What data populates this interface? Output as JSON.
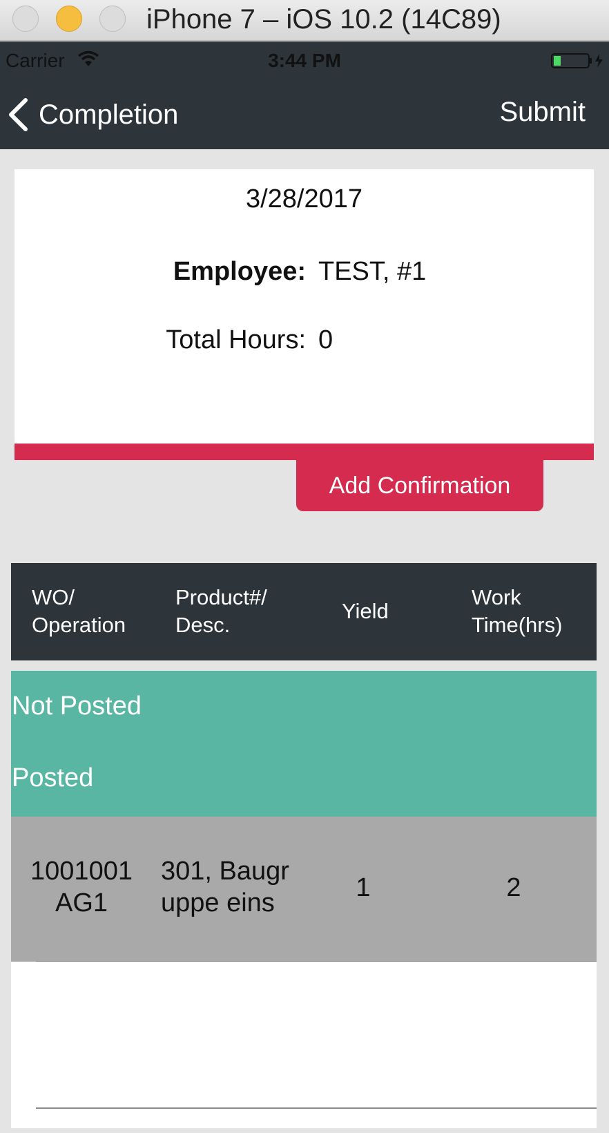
{
  "window": {
    "title": "iPhone 7 – iOS 10.2 (14C89)"
  },
  "status_bar": {
    "carrier": "Carrier",
    "time": "3:44 PM"
  },
  "nav": {
    "back_label": "Completion",
    "submit_label": "Submit"
  },
  "summary": {
    "date": "3/28/2017",
    "employee_label": "Employee:",
    "employee_value": "TEST, #1",
    "hours_label": "Total Hours:",
    "hours_value": "0"
  },
  "actions": {
    "add_confirmation": "Add Confirmation"
  },
  "table": {
    "headers": [
      {
        "line1": "WO/",
        "line2": "Operation"
      },
      {
        "line1": "Product#/",
        "line2": "Desc."
      },
      {
        "line1": "Yield",
        "line2": ""
      },
      {
        "line1": "Work",
        "line2": "Time(hrs)"
      }
    ],
    "status_sections": [
      "Not Posted",
      "Posted"
    ],
    "rows": [
      {
        "wo_line1": "1001001",
        "wo_line2": "AG1",
        "product_line1": "301, Baugr",
        "product_line2": "uppe eins",
        "yield": "1",
        "work_time": "2"
      }
    ]
  },
  "colors": {
    "nav_bg": "#2d353b",
    "accent_red": "#d42b4e",
    "status_teal": "#58b6a3",
    "row_gray": "#a9a9a9"
  }
}
